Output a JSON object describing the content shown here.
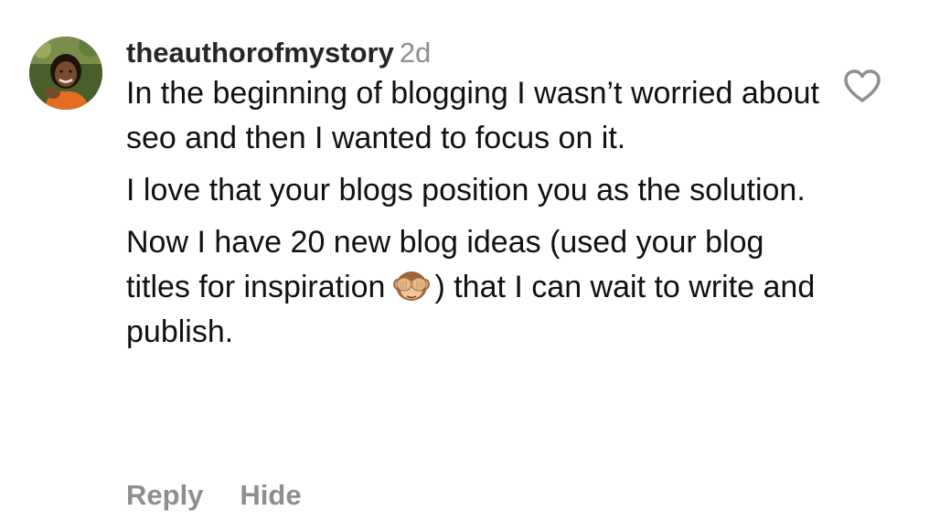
{
  "comment": {
    "username": "theauthorofmystory",
    "timestamp": "2d",
    "paragraphs": {
      "p1": "In the beginning of blogging I wasn’t worried about seo and then I wanted to focus on it.",
      "p2": "I love that your blogs position you as the solution.",
      "p3_before_emoji": "Now I have 20 new blog ideas (used your blog titles for inspiration",
      "p3_after_emoji": ") that I can wait to write and publish."
    },
    "emoji_icon": "see-no-evil-monkey-icon",
    "like_icon": "heart-outline-icon"
  },
  "actions": {
    "reply_label": "Reply",
    "hide_label": "Hide"
  },
  "colors": {
    "text": "#111111",
    "username": "#262626",
    "muted": "#8e8e8e",
    "background": "#ffffff"
  }
}
